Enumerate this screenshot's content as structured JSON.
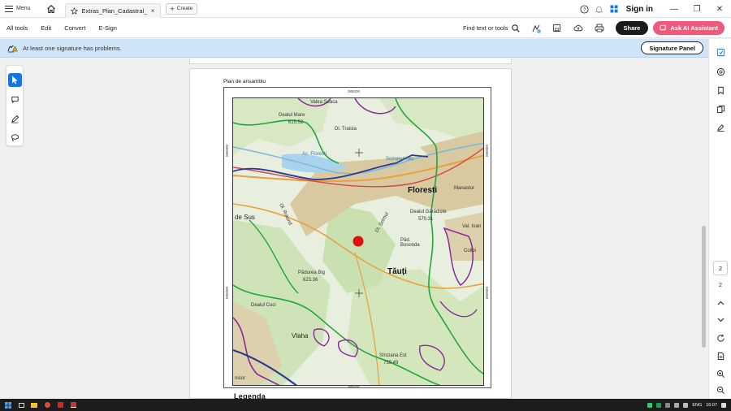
{
  "titlebar": {
    "menu_label": "Menu",
    "tab_title": "Extras_Plan_Cadastral_...",
    "create_label": "Create",
    "signin_label": "Sign in"
  },
  "toolbar": {
    "menus": [
      "All tools",
      "Edit",
      "Convert",
      "E-Sign"
    ],
    "find_label": "Find text or tools",
    "share_label": "Share",
    "ai_label": "Ask AI Assistant"
  },
  "banner": {
    "message": "At least one signature has problems.",
    "button_label": "Signature Panel"
  },
  "page_nav": {
    "current_page": "2",
    "total_pages": "2"
  },
  "document": {
    "heading": "Plan de ansamblu",
    "legend_title": "Legenda",
    "coord_top": "385000",
    "coord_bottom": "385000",
    "coord_left_top": "585000",
    "coord_left_bottom": "585000",
    "coord_right_top": "585000",
    "coord_right_bottom": "585000"
  },
  "map": {
    "labels": {
      "village_top": "Valea Seaca",
      "dealul_top": "Dealul Mare",
      "elevation_top": "615.52",
      "dl_traista": "Dl. Traista",
      "lac_floresti": "Ac. Floresti",
      "somesul": "Somesul Mic",
      "floresti": "Floresti",
      "manastur": "Manastur",
      "dealul_garadiste": "Dealul Gărădiște",
      "elev_570": "570.31",
      "val_ioan": "Val. Ioan",
      "de_sus": "de Sus",
      "dl_rotund": "Dl. Rotund",
      "dl_soimul": "Dl. Șoimul",
      "padurea_bosonda": "Păd. Bosonda",
      "colibi": "Colibi",
      "tauti": "Tăuți",
      "padurea_big": "Pădurea Big",
      "elev_623": "623.36",
      "dealul_cuci": "Dealul Cuci",
      "vlaha": "Vlaha",
      "sinzieni_est": "Sînziana Est",
      "elev_759": "759.49",
      "sanisor": "nisor"
    }
  },
  "taskbar": {
    "lang": "ENG",
    "time": "16:07"
  },
  "colors": {
    "accent_blue": "#1473e6",
    "share_black": "#1a1a1a",
    "ai_pink": "#ee5a7a",
    "banner_blue": "#cfe4f7",
    "marker_red": "#e01010"
  }
}
